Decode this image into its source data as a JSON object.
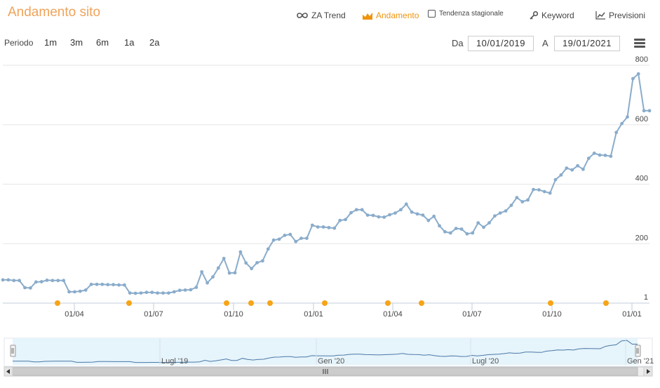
{
  "title": "Andamento sito",
  "nav": {
    "za_trend": "ZA Trend",
    "andamento": "Andamento",
    "tendenza": "Tendenza stagionale",
    "keyword": "Keyword",
    "previsioni": "Previsioni"
  },
  "periodo": {
    "label": "Periodo",
    "options": [
      "1m",
      "3m",
      "6m",
      "1a",
      "2a"
    ]
  },
  "range": {
    "from_label": "Da",
    "from_value": "10/01/2019",
    "to_label": "A",
    "to_value": "19/01/2021"
  },
  "colors": {
    "accent": "#f0940f",
    "line": "#8aaccb",
    "marker": "#f7a416"
  },
  "navigator": {
    "labels": [
      "Lugl '19",
      "Gen '20",
      "Lugl '20",
      "Gen '21"
    ]
  },
  "chart_data": {
    "type": "line",
    "x_ticks": [
      "01/04",
      "01/07",
      "01/10",
      "01/01",
      "01/04",
      "01/07",
      "01/10",
      "01/01"
    ],
    "y_ticks": [
      "1",
      "200",
      "400",
      "600",
      "800"
    ],
    "ylim": [
      0,
      800
    ],
    "grid": true,
    "series": [
      {
        "values": [
          78,
          78,
          76,
          76,
          52,
          51,
          71,
          72,
          77,
          76,
          76,
          76,
          38,
          38,
          40,
          44,
          63,
          63,
          63,
          62,
          62,
          61,
          61,
          34,
          33,
          34,
          36,
          36,
          34,
          34,
          34,
          38,
          43,
          44,
          45,
          53,
          105,
          68,
          88,
          118,
          150,
          101,
          102,
          172,
          135,
          116,
          136,
          142,
          182,
          212,
          215,
          228,
          231,
          207,
          218,
          218,
          262,
          256,
          256,
          254,
          252,
          278,
          281,
          304,
          314,
          314,
          296,
          295,
          290,
          289,
          297,
          303,
          314,
          333,
          306,
          300,
          296,
          278,
          292,
          260,
          240,
          236,
          251,
          249,
          233,
          236,
          270,
          255,
          270,
          293,
          303,
          310,
          329,
          355,
          341,
          347,
          382,
          381,
          375,
          370,
          415,
          431,
          454,
          448,
          462,
          450,
          487,
          504,
          498,
          497,
          494,
          574,
          604,
          626,
          755,
          771,
          647,
          647
        ]
      }
    ],
    "markers": [
      "01/04 -3w",
      "01/06",
      "01/10 -1w",
      "01/11 +1w",
      "01/12",
      "01/01 +1w",
      "01/04 -1w",
      "01/05",
      "01/10",
      "01/12 +2w"
    ]
  }
}
